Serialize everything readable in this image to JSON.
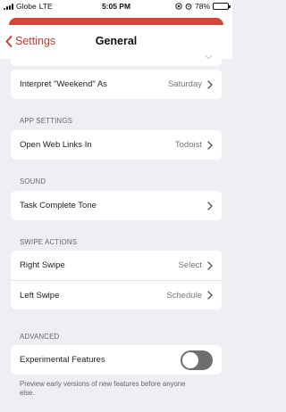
{
  "status_bar": {
    "carrier": "Globe",
    "network": "LTE",
    "time": "5:05 PM",
    "battery": "78%",
    "battery_level": 0.78
  },
  "nav": {
    "back_label": "Settings",
    "title": "General",
    "accent_color": "#d9443a"
  },
  "general": {
    "interpret_weekend": {
      "label": "Interpret \"Weekend\" As",
      "value": "Saturday"
    }
  },
  "app_settings": {
    "header": "APP SETTINGS",
    "open_web_links": {
      "label": "Open Web Links In",
      "value": "Todoist"
    }
  },
  "sound": {
    "header": "SOUND",
    "task_complete_tone": {
      "label": "Task Complete Tone"
    }
  },
  "swipe_actions": {
    "header": "SWIPE ACTIONS",
    "right_swipe": {
      "label": "Right Swipe",
      "value": "Select"
    },
    "left_swipe": {
      "label": "Left Swipe",
      "value": "Schedule"
    }
  },
  "advanced": {
    "header": "ADVANCED",
    "experimental": {
      "label": "Experimental Features",
      "enabled": false
    },
    "footnote": "Preview early versions of new features before anyone else."
  }
}
